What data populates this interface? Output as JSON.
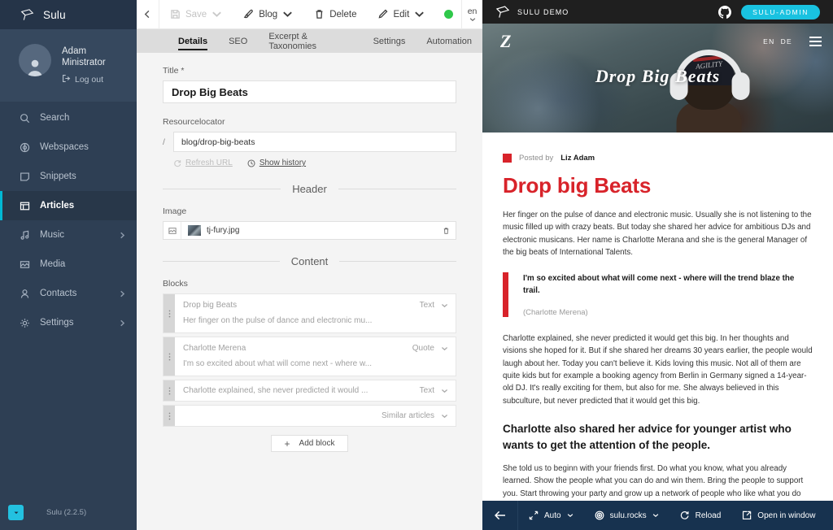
{
  "sidebar": {
    "logo_text": "Sulu",
    "user": {
      "name_line1": "Adam",
      "name_line2": "Ministrator",
      "logout_label": "Log out"
    },
    "items": [
      {
        "label": "Search",
        "icon": "search-icon",
        "chevron": false,
        "active": false
      },
      {
        "label": "Webspaces",
        "icon": "globe-icon",
        "chevron": false,
        "active": false
      },
      {
        "label": "Snippets",
        "icon": "snippet-icon",
        "chevron": false,
        "active": false
      },
      {
        "label": "Articles",
        "icon": "articles-icon",
        "chevron": false,
        "active": true
      },
      {
        "label": "Music",
        "icon": "music-icon",
        "chevron": true,
        "active": false
      },
      {
        "label": "Media",
        "icon": "media-icon",
        "chevron": false,
        "active": false
      },
      {
        "label": "Contacts",
        "icon": "contacts-icon",
        "chevron": true,
        "active": false
      },
      {
        "label": "Settings",
        "icon": "gear-icon",
        "chevron": true,
        "active": false
      }
    ],
    "version": "Sulu (2.2.5)",
    "accent_color": "#00b8d4",
    "background_color": "#2e3f54"
  },
  "toolbar": {
    "save_label": "Save",
    "blog_label": "Blog",
    "delete_label": "Delete",
    "edit_label": "Edit",
    "status_color": "#2fc84a",
    "language": "en"
  },
  "tabs": [
    {
      "label": "Details",
      "active": true
    },
    {
      "label": "SEO",
      "active": false
    },
    {
      "label": "Excerpt & Taxonomies",
      "active": false
    },
    {
      "label": "Settings",
      "active": false
    },
    {
      "label": "Automation",
      "active": false
    }
  ],
  "form": {
    "title_label": "Title *",
    "title_value": "Drop Big Beats",
    "resourcelocator_label": "Resourcelocator",
    "resourcelocator_prefix": "/",
    "resourcelocator_value": "blog/drop-big-beats",
    "refresh_url_label": "Refresh URL",
    "show_history_label": "Show history",
    "header_divider": "Header",
    "image_label": "Image",
    "image_name": "tj-fury.jpg",
    "content_divider": "Content",
    "blocks_label": "Blocks",
    "add_block_label": "Add block",
    "blocks": [
      {
        "title": "Drop big Beats",
        "subtitle": "Her finger on the pulse of dance and electronic mu...",
        "type": "Text"
      },
      {
        "title": "Charlotte Merena",
        "subtitle": "I'm so excited about what will come next - where w...",
        "type": "Quote"
      },
      {
        "title": "Charlotte explained, she never predicted it would ...",
        "subtitle": "",
        "type": "Text"
      },
      {
        "title": "",
        "subtitle": "",
        "type": "Similar articles"
      }
    ]
  },
  "preview": {
    "topbar": {
      "brand": "SULU DEMO",
      "admin_button": "SULU-ADMIN",
      "github_icon": "github-icon",
      "admin_color": "#19c2e0"
    },
    "hero": {
      "logo": "Z",
      "lang_en": "EN",
      "lang_de": "DE",
      "title": "Drop Big Beats",
      "cap_text": "AGILITY"
    },
    "article": {
      "posted_by_label": "Posted by",
      "author": "Liz Adam",
      "accent_color": "#d8232a",
      "heading": "Drop big Beats",
      "intro": "Her finger on the pulse of dance and electronic music. Usually she is not listening to the music filled up with crazy beats. But today she shared her advice for ambitious DJs and electronic musicans. Her name is Charlotte Merana and she is the general Manager of the big beats of International Talents.",
      "quote": "I'm so excited about what will come next - where will the trend blaze the trail.",
      "quote_author": "(Charlotte Merena)",
      "paragraph2": "Charlotte explained, she never predicted it would get this big. In her thoughts and visions she hoped for it. But if she shared her dreams 30 years earlier, the people would laugh about her. Today you can't believe it. Kids loving this music. Not all of them are quite kids but for example a booking agency from Berlin in Germany signed a 14-year-old DJ. It's really exciting for them, but also for me. She always believed in this subculture, but never predicted that it would get this big.",
      "subheading": "Charlotte also shared her advice for younger artist who wants to get the attention of the people.",
      "paragraph3": "She told us to beginn with your friends first. Do what you know, what you already learned. Show the people what you can do and win them. Bring the people to support you. Start throwing your party and grow up a network of people who like what you do and are excited about what you do. Don't make a fanbpage, and put your sounds on Soundcloud or do a crazy Photoshooing."
    },
    "bottombar": {
      "size_label": "Auto",
      "webspace_label": "sulu.rocks",
      "reload_label": "Reload",
      "open_window_label": "Open in window",
      "background_color": "#17324f"
    }
  }
}
